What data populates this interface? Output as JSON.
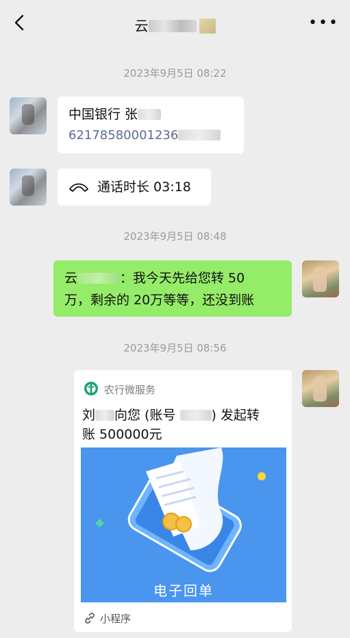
{
  "header": {
    "title_prefix": "云",
    "back_icon": "chevron-left-icon",
    "more_icon": "more-dots-icon",
    "more_text": "•••"
  },
  "messages": {
    "ts1": "2023年9月5日 08:22",
    "bank_card_line1": "中国银行 张",
    "bank_card_account": "62178580001236",
    "call_label": "通话时长 03:18",
    "ts2": "2023年9月5日 08:48",
    "sent_prefix": "云",
    "sent_text_line1": "：我今天先给您转 50",
    "sent_text_line2": "万，剩余的 20万等等，还没到账",
    "ts3": "2023年9月5日 08:56"
  },
  "mini_program": {
    "service_name": "农行微服务",
    "line1_a": "刘",
    "line1_b": "向您 (账号",
    "line1_c": ") 发起转",
    "line2": "账 500000元",
    "image_label": "电子回单",
    "footer_label": "小程序"
  },
  "colors": {
    "background": "#ededed",
    "sent_bubble": "#95ec69",
    "link_blue": "#576b95",
    "promo_blue": "#4a95ed",
    "abc_green": "#1aa37a"
  }
}
